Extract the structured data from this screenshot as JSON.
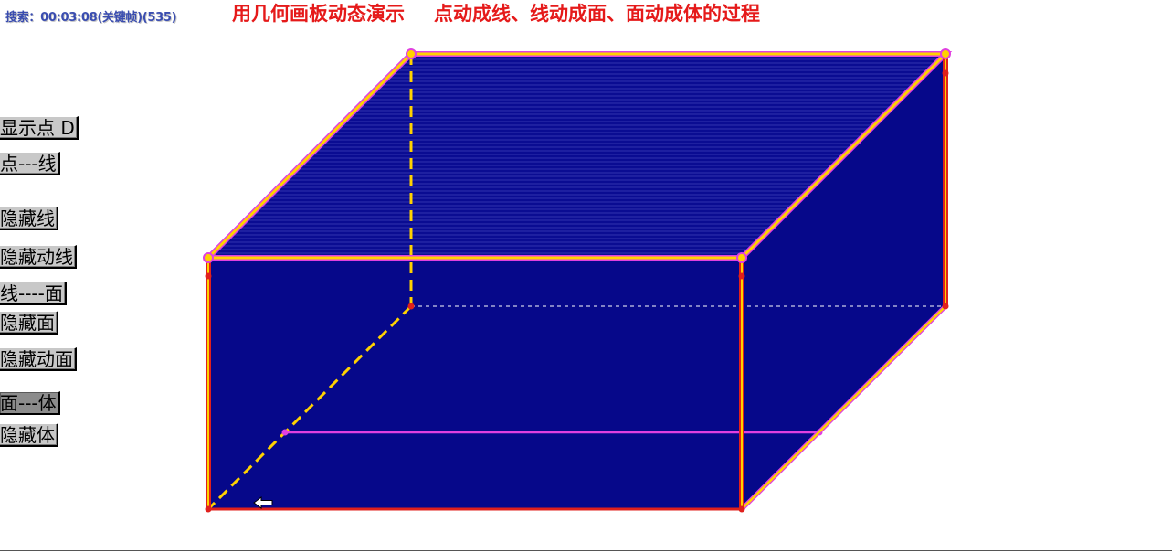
{
  "header": {
    "seek_label": "搜索：00:03:08(关键帧)(535)",
    "title_part1": "用几何画板动态演示",
    "title_part2": "点动成线、线动成面、面动成体的过程"
  },
  "buttons": [
    {
      "label": "显示点 D",
      "pressed": false
    },
    {
      "label": "点---线",
      "pressed": false
    },
    {
      "label": "隐藏线",
      "pressed": false
    },
    {
      "label": "隐藏动线",
      "pressed": false
    },
    {
      "label": "线----面",
      "pressed": false
    },
    {
      "label": "隐藏面",
      "pressed": false
    },
    {
      "label": "隐藏动面",
      "pressed": false
    },
    {
      "label": "面---体",
      "pressed": true
    },
    {
      "label": "隐藏体",
      "pressed": false
    }
  ],
  "colors": {
    "fill": "#06088a",
    "edge_yellow": "#ffd200",
    "edge_red": "#e0201c",
    "magenta": "#e040e0",
    "title_red": "#e51a1a"
  },
  "icons": {
    "cursor": "arrow-cursor-icon"
  }
}
